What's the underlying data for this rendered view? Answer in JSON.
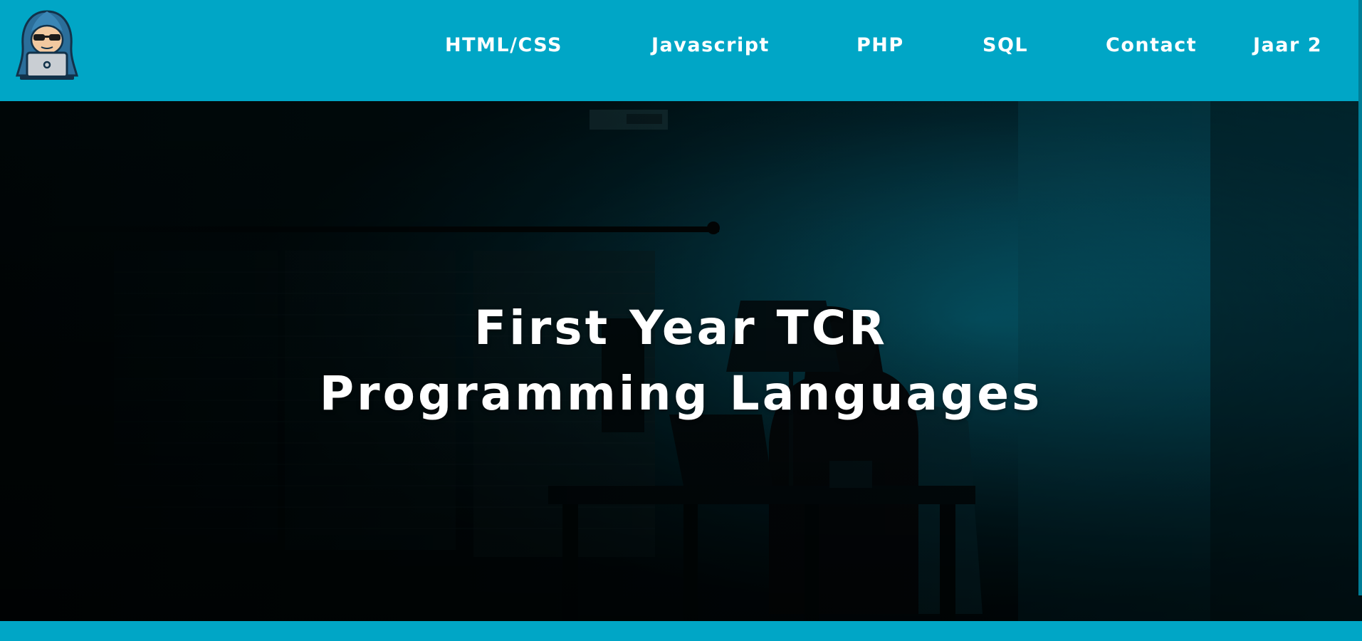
{
  "header": {
    "logo_icon": "hacker-with-laptop-icon",
    "nav": [
      {
        "label": "HTML/CSS"
      },
      {
        "label": "Javascript"
      },
      {
        "label": "PHP"
      },
      {
        "label": "SQL"
      },
      {
        "label": "Contact"
      },
      {
        "label": "Jaar 2"
      }
    ]
  },
  "hero": {
    "line1": "First Year TCR",
    "line2": "Programming Languages"
  },
  "colors": {
    "brand": "#00a6c6",
    "text": "#ffffff",
    "hero_dark": "#011a20",
    "hero_glow": "#0a8fb0"
  }
}
